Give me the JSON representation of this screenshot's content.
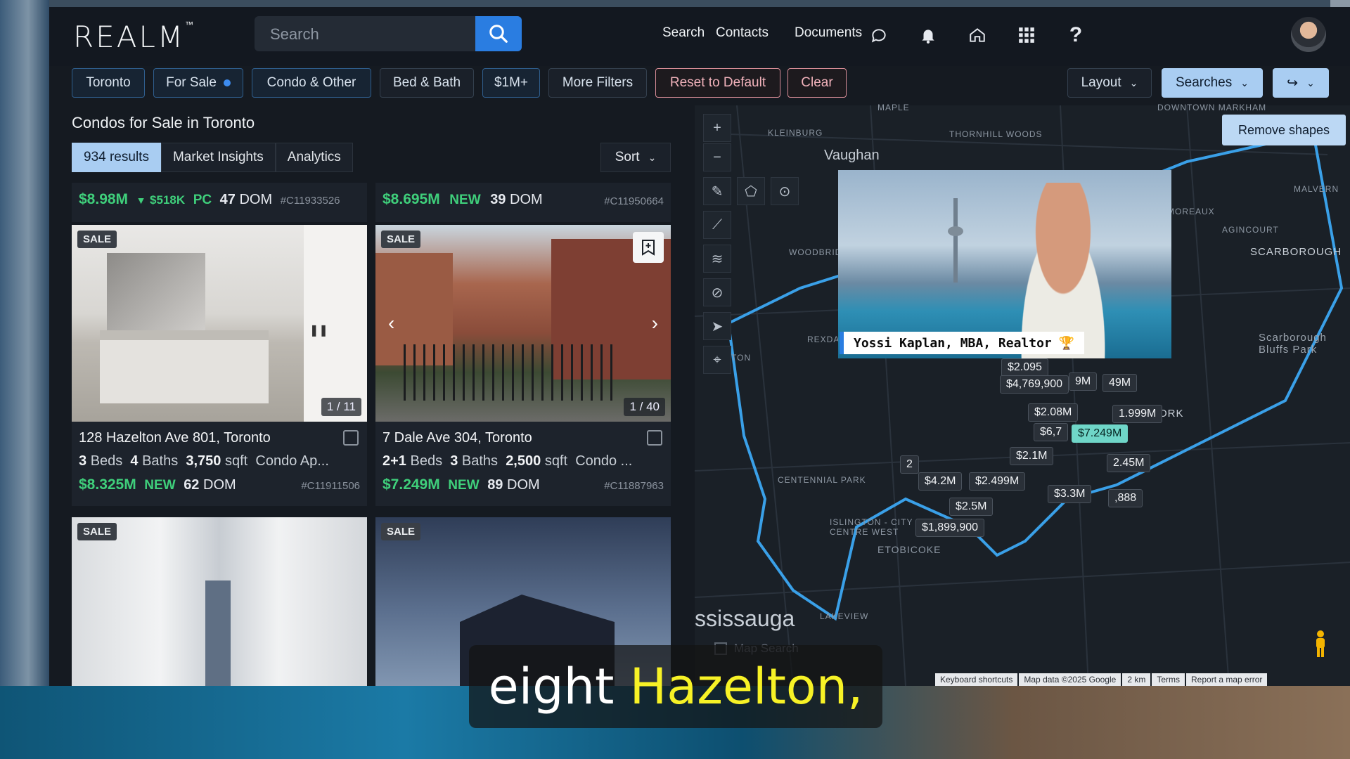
{
  "brand": {
    "logo": "REALM",
    "tm": "™"
  },
  "search": {
    "placeholder": "Search"
  },
  "nav": {
    "search": "Search",
    "contacts": "Contacts",
    "documents": "Documents"
  },
  "filters": {
    "location": "Toronto",
    "status": "For Sale",
    "type": "Condo & Other",
    "bedbath": "Bed & Bath",
    "price": "$1M+",
    "more": "More Filters",
    "reset": "Reset to Default",
    "clear": "Clear",
    "layout": "Layout",
    "searches": "Searches"
  },
  "list": {
    "title": "Condos for Sale in Toronto",
    "tabs": [
      "934 results",
      "Market Insights",
      "Analytics"
    ],
    "sort": "Sort"
  },
  "strip": [
    {
      "price": "$8.98M",
      "change": "$518K",
      "tag": "PC",
      "dom": "47",
      "dom_label": "DOM",
      "mls": "#C11933526"
    },
    {
      "price": "$8.695M",
      "tag": "NEW",
      "dom": "39",
      "dom_label": "DOM",
      "mls": "#C11950664"
    }
  ],
  "listings": [
    {
      "badge": "SALE",
      "counter": "1 / 11",
      "address": "128 Hazelton Ave 801, Toronto",
      "beds": "3",
      "beds_label": "Beds",
      "baths": "4",
      "baths_label": "Baths",
      "sqft": "3,750",
      "sqft_label": "sqft",
      "kind": "Condo Ap...",
      "price": "$8.325M",
      "tag": "NEW",
      "dom": "62",
      "dom_label": "DOM",
      "mls": "#C11911506"
    },
    {
      "badge": "SALE",
      "counter": "1 / 40",
      "address": "7 Dale Ave 304, Toronto",
      "beds": "2+1",
      "beds_label": "Beds",
      "baths": "3",
      "baths_label": "Baths",
      "sqft": "2,500",
      "sqft_label": "sqft",
      "kind": "Condo ...",
      "price": "$7.249M",
      "tag": "NEW",
      "dom": "89",
      "dom_label": "DOM",
      "mls": "#C11887963"
    },
    {
      "badge": "SALE"
    },
    {
      "badge": "SALE"
    }
  ],
  "map": {
    "remove_shapes": "Remove shapes",
    "labels": [
      "MAPLE",
      "DOWNTOWN MARKHAM",
      "KLEINBURG",
      "THORNHILL WOODS",
      "MALVERN",
      "MOREAUX",
      "AGINCOURT",
      "SCARBOROUGH",
      "WOODBRIDGE",
      "REXDA",
      "TON",
      "CENTENNIAL PARK",
      "ISLINGTON - CITY CENTRE WEST",
      "ETOBICOKE",
      "LAKEVIEW",
      "ORK",
      "Scarborough Bluffs Park"
    ],
    "cities": [
      "Vaughan",
      "ssissauga"
    ],
    "pins": [
      "$2.095",
      "$4,769,900",
      "9M",
      "49M",
      "$2.08M",
      "$7.249M",
      "1.999M",
      "$6,7",
      "$2.1M",
      "2.45M",
      "2",
      "$4.2M",
      "$2.499M",
      "$3.3M",
      ",888",
      "$2.5M",
      "$1,899,900"
    ],
    "map_search": "Map Search",
    "footer": [
      "Keyboard shortcuts",
      "Map data ©2025 Google",
      "2 km",
      "Terms",
      "Report a map error"
    ]
  },
  "video": {
    "name_tag": "Yossi Kaplan, MBA, Realtor",
    "trophy": "🏆"
  },
  "caption": {
    "white": "eight ",
    "yellow": "Hazelton,"
  },
  "colors": {
    "accent": "#2a7de1",
    "price_green": "#3fcf7b",
    "highlight_pin": "#6fd6c8",
    "chip_active": "#a9cdf2"
  }
}
